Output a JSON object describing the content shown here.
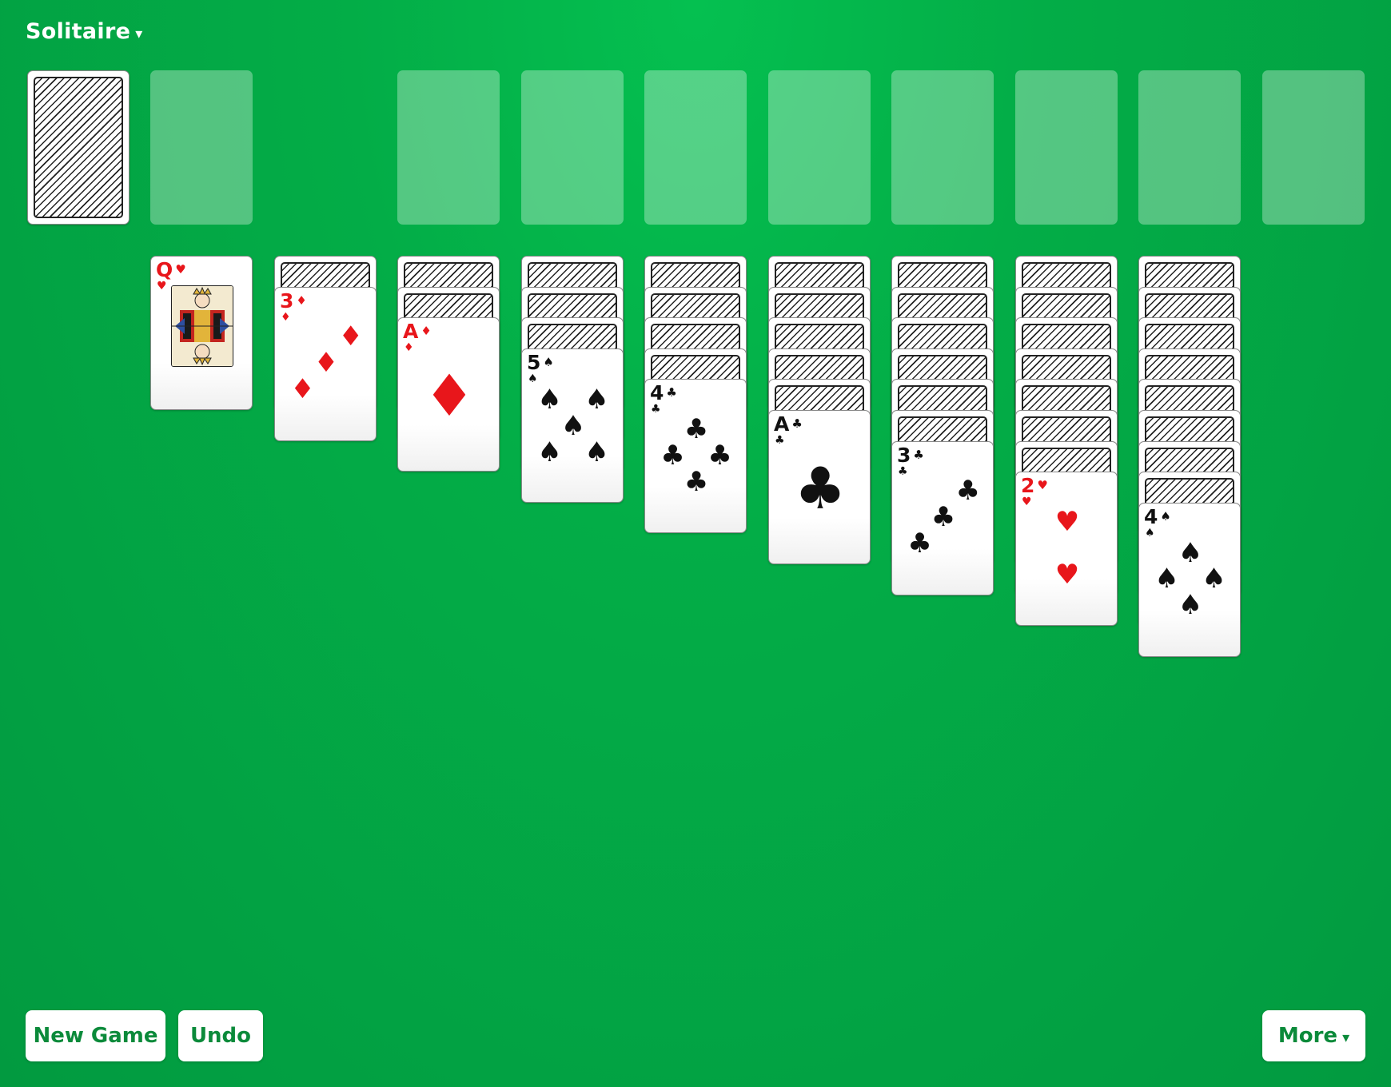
{
  "header": {
    "title": "Solitaire",
    "caret": "▾"
  },
  "stock": {
    "count_visible": 1
  },
  "foundations": 8,
  "suits": {
    "hearts": "♥",
    "diamonds": "♦",
    "spades": "♠",
    "clubs": "♣"
  },
  "colors": {
    "red": "#e8161b",
    "black": "#111111",
    "table": "#03ad47",
    "button_text": "#0b8a3a"
  },
  "tableau": [
    {
      "face_down": 0,
      "face_up": [
        {
          "rank": "Q",
          "suit": "hearts"
        }
      ]
    },
    {
      "face_down": 1,
      "face_up": [
        {
          "rank": "3",
          "suit": "diamonds"
        }
      ]
    },
    {
      "face_down": 2,
      "face_up": [
        {
          "rank": "A",
          "suit": "diamonds"
        }
      ]
    },
    {
      "face_down": 3,
      "face_up": [
        {
          "rank": "5",
          "suit": "spades"
        }
      ]
    },
    {
      "face_down": 4,
      "face_up": [
        {
          "rank": "4",
          "suit": "clubs"
        }
      ]
    },
    {
      "face_down": 5,
      "face_up": [
        {
          "rank": "A",
          "suit": "clubs"
        }
      ]
    },
    {
      "face_down": 6,
      "face_up": [
        {
          "rank": "3",
          "suit": "clubs"
        }
      ]
    },
    {
      "face_down": 7,
      "face_up": [
        {
          "rank": "2",
          "suit": "hearts"
        }
      ]
    },
    {
      "face_down": 8,
      "face_up": [
        {
          "rank": "4",
          "suit": "spades"
        }
      ]
    }
  ],
  "buttons": {
    "new_game": "New Game",
    "undo": "Undo",
    "more": "More",
    "more_caret": "▾"
  }
}
